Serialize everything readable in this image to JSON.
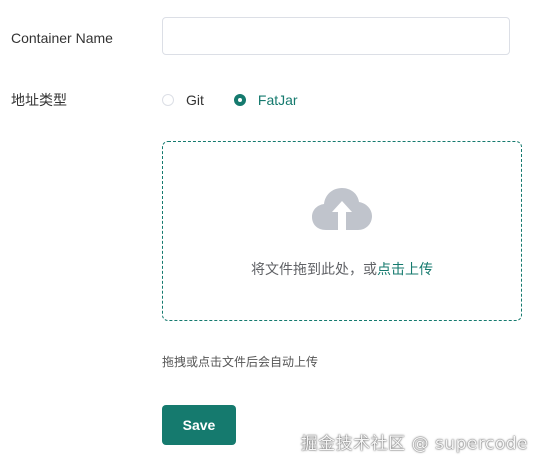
{
  "form": {
    "container_name_label": "Container Name",
    "container_name_value": "",
    "container_name_placeholder": "",
    "type_label": "地址类型",
    "radio_options": [
      {
        "label": "Git",
        "checked": false
      },
      {
        "label": "FatJar",
        "checked": true
      }
    ]
  },
  "upload": {
    "icon": "cloud-upload-icon",
    "text_prefix": "将文件拖到此处，或",
    "link_text": "点击上传",
    "tip": "拖拽或点击文件后会自动上传"
  },
  "actions": {
    "save_label": "Save"
  },
  "watermark": "掘金技术社区 @ supercode",
  "colors": {
    "accent": "#157a6e",
    "border": "#dcdfe6",
    "icon_gray": "#c0c4cc"
  }
}
